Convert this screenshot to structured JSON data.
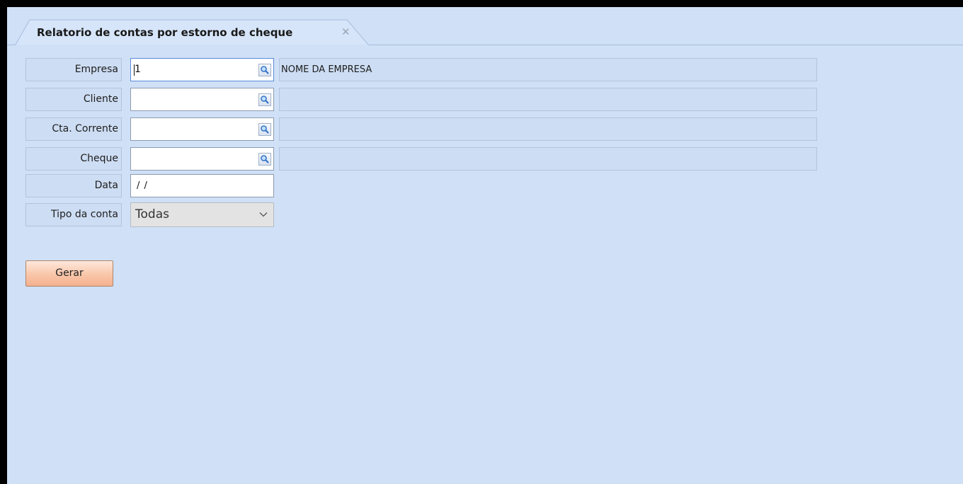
{
  "tab": {
    "title": "Relatorio de contas por estorno de cheque",
    "close_glyph": "✕"
  },
  "form": {
    "empresa": {
      "label": "Empresa",
      "code": "1",
      "name": "NOME DA EMPRESA",
      "lookup_icon": "search-icon"
    },
    "cliente": {
      "label": "Cliente",
      "code": "",
      "name": "",
      "lookup_icon": "search-icon"
    },
    "cta_corrente": {
      "label": "Cta. Corrente",
      "code": "",
      "name": "",
      "lookup_icon": "search-icon"
    },
    "cheque": {
      "label": "Cheque",
      "code": "",
      "name": "",
      "lookup_icon": "search-icon"
    },
    "data": {
      "label": "Data",
      "value": "/ /"
    },
    "tipo_conta": {
      "label": "Tipo da conta",
      "selected": "Todas"
    }
  },
  "actions": {
    "gerar_label": "Gerar"
  },
  "colors": {
    "background": "#cfe0f7",
    "label_bg": "#cdddf3",
    "button_orange": "#f9c6a9"
  }
}
